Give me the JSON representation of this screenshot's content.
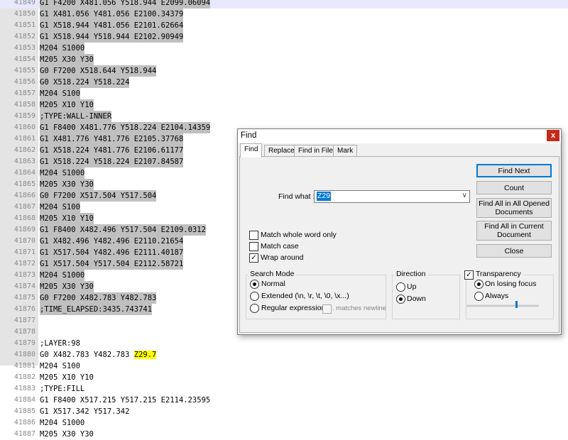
{
  "editor": {
    "lines": [
      {
        "n": "41849",
        "t": "G1 F4200 X481.056 Y518.944 E2099.06094",
        "sel": true,
        "current": true
      },
      {
        "n": "41850",
        "t": "G1 X481.056 Y481.056 E2100.34379",
        "sel": true
      },
      {
        "n": "41851",
        "t": "G1 X518.944 Y481.056 E2101.62664",
        "sel": true
      },
      {
        "n": "41852",
        "t": "G1 X518.944 Y518.944 E2102.90949",
        "sel": true
      },
      {
        "n": "41853",
        "t": "M204 S1000",
        "sel": true
      },
      {
        "n": "41854",
        "t": "M205 X30 Y30",
        "sel": true
      },
      {
        "n": "41855",
        "t": "G0 F7200 X518.644 Y518.944",
        "sel": true
      },
      {
        "n": "41856",
        "t": "G0 X518.224 Y518.224",
        "sel": true
      },
      {
        "n": "41857",
        "t": "M204 S100",
        "sel": true
      },
      {
        "n": "41858",
        "t": "M205 X10 Y10",
        "sel": true
      },
      {
        "n": "41859",
        "t": ";TYPE:WALL-INNER",
        "sel": true
      },
      {
        "n": "41860",
        "t": "G1 F8400 X481.776 Y518.224 E2104.14359",
        "sel": true
      },
      {
        "n": "41861",
        "t": "G1 X481.776 Y481.776 E2105.37768",
        "sel": true
      },
      {
        "n": "41862",
        "t": "G1 X518.224 Y481.776 E2106.61177",
        "sel": true
      },
      {
        "n": "41863",
        "t": "G1 X518.224 Y518.224 E2107.84587",
        "sel": true
      },
      {
        "n": "41864",
        "t": "M204 S1000",
        "sel": true
      },
      {
        "n": "41865",
        "t": "M205 X30 Y30",
        "sel": true
      },
      {
        "n": "41866",
        "t": "G0 F7200 X517.504 Y517.504",
        "sel": true
      },
      {
        "n": "41867",
        "t": "M204 S100",
        "sel": true
      },
      {
        "n": "41868",
        "t": "M205 X10 Y10",
        "sel": true
      },
      {
        "n": "41869",
        "t": "G1 F8400 X482.496 Y517.504 E2109.0312",
        "sel": true
      },
      {
        "n": "41870",
        "t": "G1 X482.496 Y482.496 E2110.21654",
        "sel": true
      },
      {
        "n": "41871",
        "t": "G1 X517.504 Y482.496 E2111.40187",
        "sel": true
      },
      {
        "n": "41872",
        "t": "G1 X517.504 Y517.504 E2112.58721",
        "sel": true
      },
      {
        "n": "41873",
        "t": "M204 S1000",
        "sel": true
      },
      {
        "n": "41874",
        "t": "M205 X30 Y30",
        "sel": true
      },
      {
        "n": "41875",
        "t": "G0 F7200 X482.783 Y482.783",
        "sel": true
      },
      {
        "n": "41876",
        "t": ";TIME_ELAPSED:3435.743741",
        "sel": true
      },
      {
        "n": "41877",
        "t": "",
        "sel": false
      },
      {
        "n": "41878",
        "t": "",
        "sel": false
      },
      {
        "n": "41879",
        "t": ";LAYER:98",
        "sel": false
      },
      {
        "n": "41880",
        "t": "G0 X482.783 Y482.783 ",
        "mark": "Z29.7",
        "sel": false
      },
      {
        "n": "41881",
        "t": "M204 S100",
        "sel": false
      },
      {
        "n": "41882",
        "t": "M205 X10 Y10",
        "sel": false
      },
      {
        "n": "41883",
        "t": ";TYPE:FILL",
        "sel": false
      },
      {
        "n": "41884",
        "t": "G1 F8400 X517.215 Y517.215 E2114.23595",
        "sel": false
      },
      {
        "n": "41885",
        "t": "G1 X517.342 Y517.342",
        "sel": false
      },
      {
        "n": "41886",
        "t": "M204 S1000",
        "sel": false
      },
      {
        "n": "41887",
        "t": "M205 X30 Y30",
        "sel": false
      }
    ]
  },
  "dialog": {
    "title": "Find",
    "close_glyph": "x",
    "tabs": [
      "Find",
      "Replace",
      "Find in Files",
      "Mark"
    ],
    "find_what_label": "Find what :",
    "find_what_value": "Z29",
    "dropdown_glyph": "∨",
    "buttons": {
      "find_next": "Find Next",
      "count": "Count",
      "find_all_opened": "Find All in All Opened Documents",
      "find_all_current": "Find All in Current Document",
      "close": "Close"
    },
    "options": {
      "match_whole_word": {
        "label": "Match whole word only",
        "checked": false
      },
      "match_case": {
        "label": "Match case",
        "checked": false
      },
      "wrap_around": {
        "label": "Wrap around",
        "checked": true
      }
    },
    "check_glyph": "✓",
    "search_mode": {
      "title": "Search Mode",
      "normal": "Normal",
      "extended": "Extended (\\n, \\r, \\t, \\0, \\x...)",
      "regex": "Regular expression",
      "matches_newline": ". matches newline",
      "selected": "normal"
    },
    "direction": {
      "title": "Direction",
      "up": "Up",
      "down": "Down",
      "selected": "down"
    },
    "transparency": {
      "title": "Transparency",
      "checked": true,
      "on_losing_focus": "On losing focus",
      "always": "Always",
      "selected": "on_losing_focus",
      "slider_level_percent": 70
    }
  }
}
